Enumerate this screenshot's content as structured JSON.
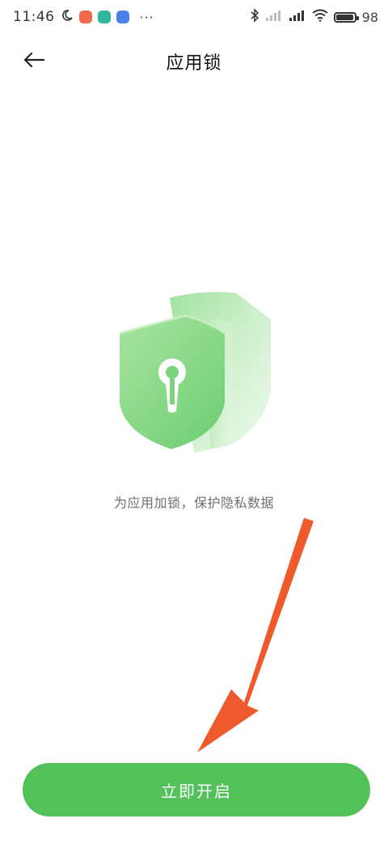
{
  "status_bar": {
    "time": "11:46",
    "battery_text": "98",
    "battery_level": 0.98,
    "icons": [
      "moon-icon",
      "app-notification-icon",
      "app-notification-icon",
      "app-notification-icon",
      "bluetooth-icon",
      "signal-icon",
      "signal-icon",
      "wifi-icon",
      "battery-icon"
    ],
    "more": "···"
  },
  "header": {
    "title": "应用锁",
    "back_icon": "arrow-left-icon"
  },
  "main": {
    "illustration": "shield-lock-icon",
    "description": "为应用加锁，保护隐私数据"
  },
  "cta": {
    "label": "立即开启"
  },
  "colors": {
    "accent": "#52c15a",
    "annotation_arrow": "#ee5a2b"
  }
}
